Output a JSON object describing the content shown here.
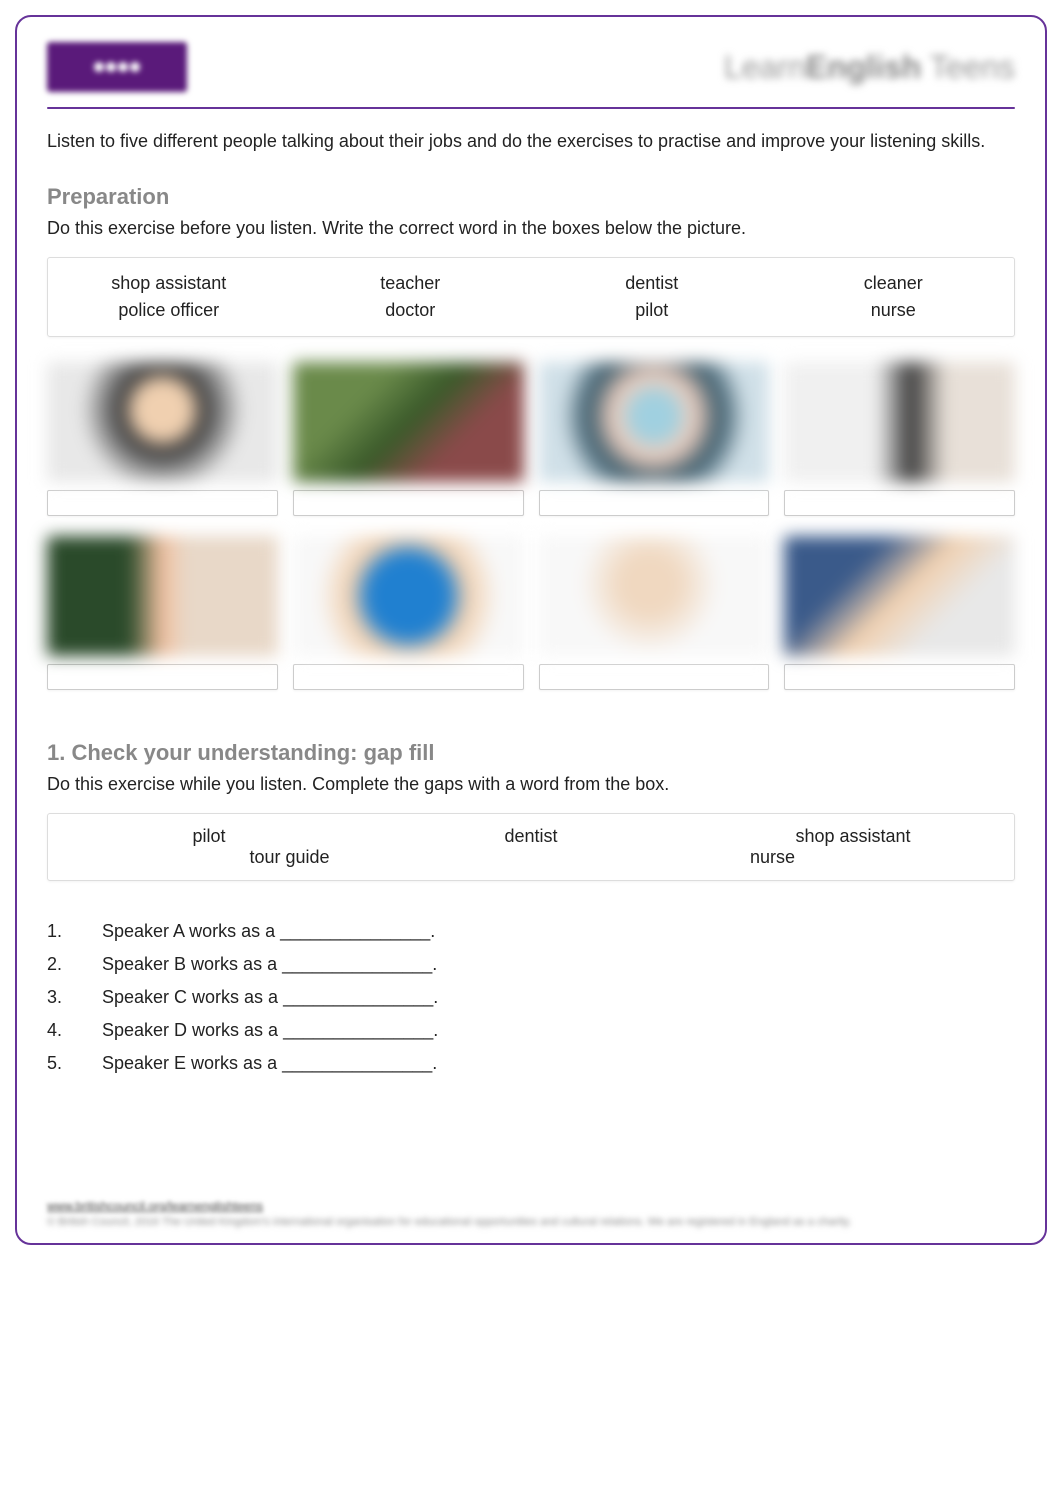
{
  "header": {
    "logo_alt_left": "British Council",
    "logo_text_right_plain": "Learn",
    "logo_text_right_bold": "English",
    "logo_text_right_tail": " Teens"
  },
  "intro": "Listen to five different people talking about their jobs and do the exercises to practise and improve your listening skills.",
  "preparation": {
    "heading": "Preparation",
    "instructions": "Do this exercise before you listen. Write the correct word in the boxes below the picture.",
    "word_bank": {
      "row1": [
        "shop assistant",
        "teacher",
        "dentist",
        "cleaner"
      ],
      "row2": [
        "police officer",
        "doctor",
        "pilot",
        "nurse"
      ]
    }
  },
  "gap_fill": {
    "heading": "1. Check your understanding: gap fill",
    "instructions": "Do this exercise while you listen. Complete the gaps with a word from the box.",
    "word_bank": {
      "row1": [
        "pilot",
        "dentist",
        "shop assistant"
      ],
      "row2": [
        "tour guide",
        "nurse"
      ]
    },
    "items": [
      {
        "num": "1.",
        "text": "Speaker A works as a _______________."
      },
      {
        "num": "2.",
        "text": "Speaker B works as a _______________."
      },
      {
        "num": "3.",
        "text": "Speaker C works as a _______________."
      },
      {
        "num": "4.",
        "text": "Speaker D works as a _______________."
      },
      {
        "num": "5.",
        "text": "Speaker E works as a _______________."
      }
    ]
  },
  "footer": {
    "link": "www.britishcouncil.org/learnenglishteens",
    "copyright": "© British Council, 2016 The United Kingdom's international organisation for educational opportunities and cultural relations. We are registered in England as a charity."
  }
}
